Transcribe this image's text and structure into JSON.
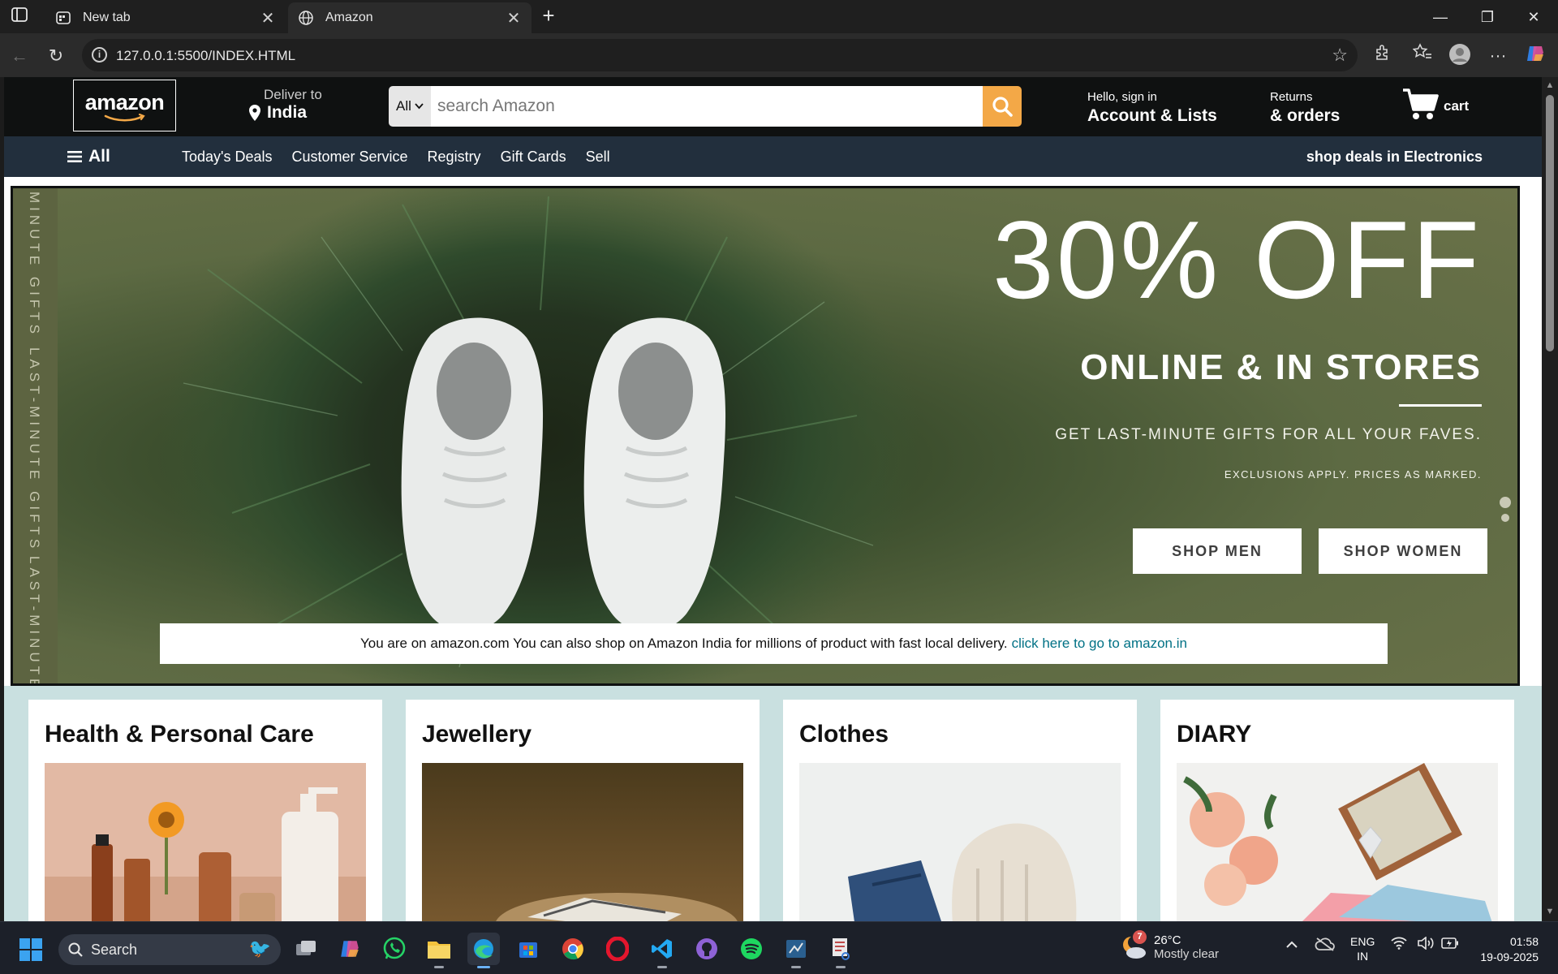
{
  "browser": {
    "tabs": [
      {
        "title": "New tab",
        "icon": "new-tab-icon",
        "active": false
      },
      {
        "title": "Amazon",
        "icon": "globe-icon",
        "active": true
      }
    ],
    "url": "127.0.0.1:5500/INDEX.HTML"
  },
  "header": {
    "logo_text": "amazon",
    "deliver_label": "Deliver to",
    "deliver_location": "India",
    "search_category": "All",
    "search_placeholder": "search Amazon",
    "account_greeting": "Hello, sign in",
    "account_label": "Account & Lists",
    "returns_label": "Returns",
    "orders_label": "& orders",
    "cart_label": "cart"
  },
  "nav": {
    "all_label": "All",
    "links": [
      "Today's Deals",
      "Customer Service",
      "Registry",
      "Gift Cards",
      "Sell"
    ],
    "promo": "shop deals in Electronics"
  },
  "hero": {
    "side_text": [
      "MINUTE GIFTS",
      "LAST-MINUTE GIFTS",
      "LAST-MINUTE G"
    ],
    "headline": "30% OFF",
    "subheadline": "ONLINE & IN STORES",
    "tagline": "GET LAST-MINUTE GIFTS FOR ALL YOUR FAVES.",
    "exclusions": "EXCLUSIONS APPLY. PRICES AS MARKED.",
    "btn_men": "SHOP MEN",
    "btn_women": "SHOP WOMEN",
    "notice": "You are on amazon.com You can also shop on Amazon India for millions of product with fast local delivery.",
    "notice_link": "click here to go to amazon.in"
  },
  "categories": [
    {
      "title": "Health & Personal Care"
    },
    {
      "title": "Jewellery"
    },
    {
      "title": "Clothes"
    },
    {
      "title": "DIARY"
    }
  ],
  "taskbar": {
    "search_label": "Search",
    "weather_temp": "26°C",
    "weather_cond": "Mostly clear",
    "weather_badge": "7",
    "lang_line1": "ENG",
    "lang_line2": "IN",
    "time": "01:58",
    "date": "19-09-2025"
  },
  "colors": {
    "amazon_dark": "#0f1111",
    "amazon_nav": "#222f3d",
    "search_button": "#f3a847",
    "link": "#007185",
    "cards_bg": "#c9e0e0"
  }
}
